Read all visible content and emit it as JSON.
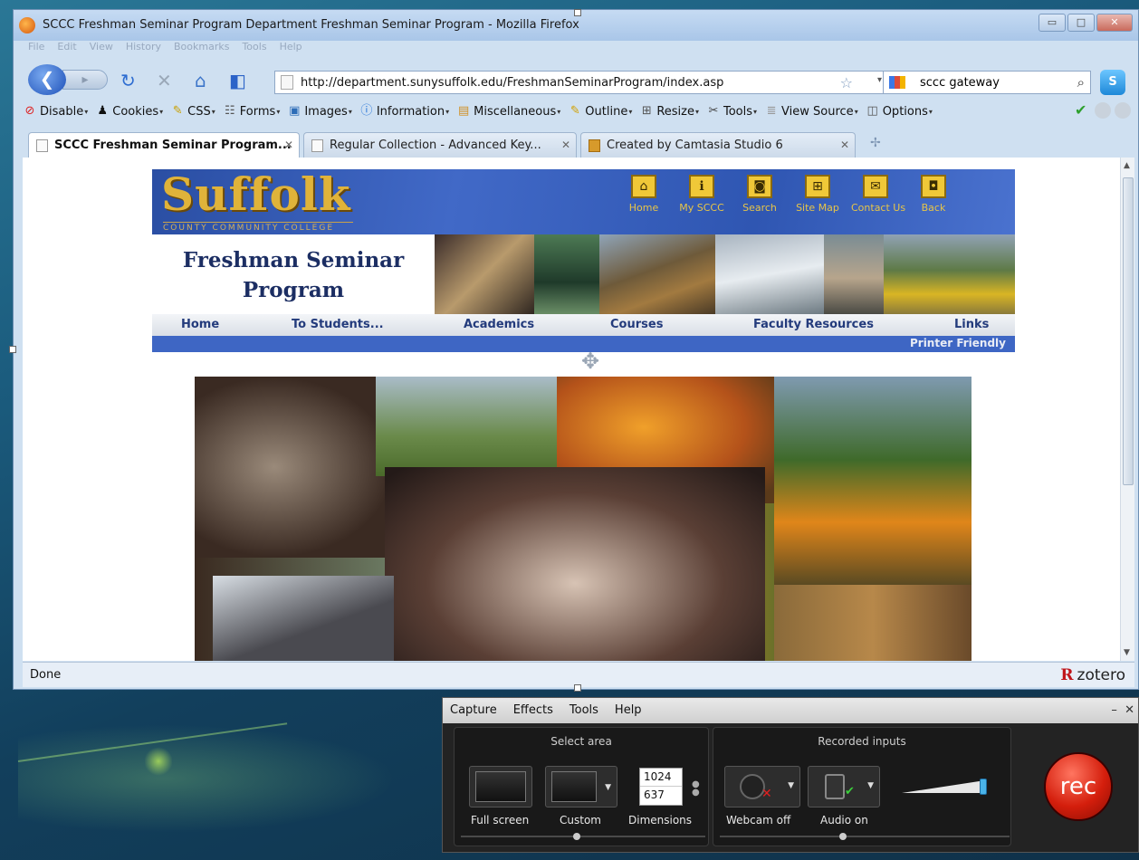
{
  "window": {
    "title": "SCCC Freshman Seminar Program Department Freshman Seminar Program - Mozilla Firefox",
    "controls": {
      "minimize": "▭",
      "maximize": "□",
      "close": "✕"
    }
  },
  "menubar": [
    "File",
    "Edit",
    "View",
    "History",
    "Bookmarks",
    "Tools",
    "Help"
  ],
  "nav": {
    "url": "http://department.sunysuffolk.edu/FreshmanSeminarProgram/index.asp",
    "search_value": "sccc gateway"
  },
  "devbar": {
    "items": [
      "Disable",
      "Cookies",
      "CSS",
      "Forms",
      "Images",
      "Information",
      "Miscellaneous",
      "Outline",
      "Resize",
      "Tools",
      "View Source",
      "Options"
    ]
  },
  "tabs": [
    {
      "label": "SCCC Freshman Seminar Program..."
    },
    {
      "label": "Regular Collection - Advanced Key..."
    },
    {
      "label": "Created by Camtasia Studio 6"
    }
  ],
  "page": {
    "logo": "Suffolk",
    "logo_sub": "COUNTY COMMUNITY COLLEGE",
    "header_nav": [
      "Home",
      "My SCCC",
      "Search",
      "Site Map",
      "Contact Us",
      "Back"
    ],
    "title_line1": "Freshman Seminar",
    "title_line2": "Program",
    "main_nav": [
      "Home",
      "To Students...",
      "Academics",
      "Courses",
      "Faculty Resources",
      "Links"
    ],
    "printer_friendly": "Printer Friendly"
  },
  "status": {
    "text": "Done",
    "zotero": "zotero"
  },
  "recorder": {
    "menu": [
      "Capture",
      "Effects",
      "Tools",
      "Help"
    ],
    "select_area_title": "Select area",
    "recorded_inputs_title": "Recorded inputs",
    "full_screen": "Full screen",
    "custom": "Custom",
    "dimensions": "Dimensions",
    "width": "1024",
    "height": "637",
    "webcam": "Webcam off",
    "audio": "Audio on",
    "rec": "rec"
  }
}
